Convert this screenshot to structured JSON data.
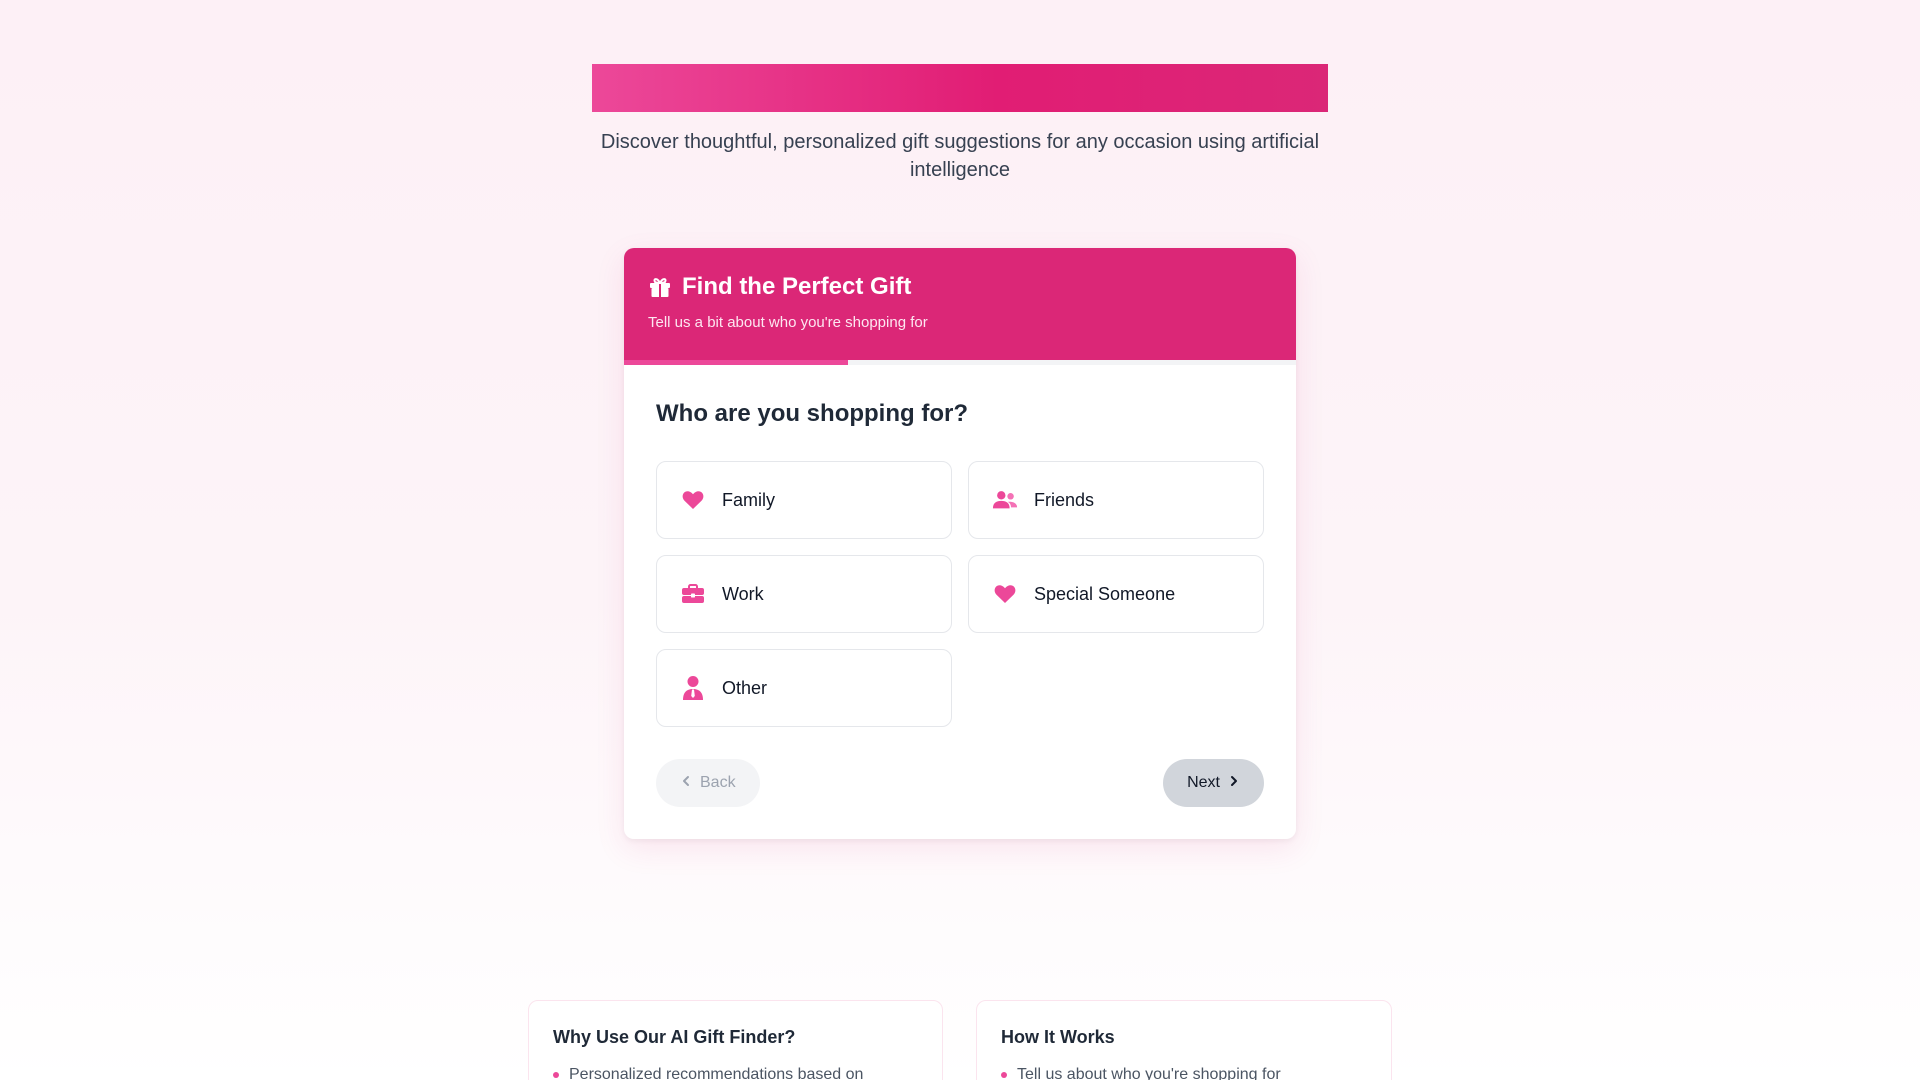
{
  "hero": {
    "tagline": "Discover thoughtful, personalized gift suggestions for any occasion using artificial intelligence"
  },
  "finder": {
    "title": "Find the Perfect Gift",
    "subtitle": "Tell us a bit about who you're shopping for",
    "progress_fraction": 0.333,
    "question": "Who are you shopping for?",
    "options": [
      {
        "label": "Family",
        "icon": "heart-icon"
      },
      {
        "label": "Friends",
        "icon": "users-icon"
      },
      {
        "label": "Work",
        "icon": "briefcase-icon"
      },
      {
        "label": "Special Someone",
        "icon": "heart-icon"
      },
      {
        "label": "Other",
        "icon": "user-tie-icon"
      }
    ],
    "back_label": "Back",
    "next_label": "Next"
  },
  "info": {
    "why_title": "Why Use Our AI Gift Finder?",
    "why_first": "Personalized recommendations based on",
    "how_title": "How It Works",
    "how_first": "Tell us about who you're shopping for"
  },
  "colors": {
    "accent": "#db2777",
    "accent_light": "#ec4899"
  }
}
